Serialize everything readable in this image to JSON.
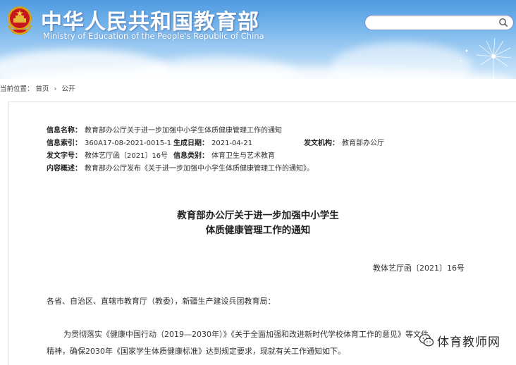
{
  "header": {
    "site_title": "中华人民共和国教育部",
    "site_subtitle": "Ministry of Education of the People's Republic of China",
    "search": {
      "value": "",
      "placeholder": ""
    }
  },
  "breadcrumb": {
    "prefix": "当前位置：",
    "items": [
      "首页",
      "公开"
    ],
    "separator": "›"
  },
  "meta": {
    "name_label": "信息名称：",
    "name_value": "教育部办公厅关于进一步加强中小学生体质健康管理工作的通知",
    "index_label": "信息索引：",
    "index_value": "360A17-08-2021-0015-1",
    "date_label": "生成日期：",
    "date_value": "2021-04-21",
    "org_label": "发文机构：",
    "org_value": "教育部办公厅",
    "docno_label": "发文字号：",
    "docno_value": "教体艺厅函〔2021〕16号",
    "category_label": "信息类别：",
    "category_value": "体育卫生与艺术教育",
    "summary_label": "内容概述：",
    "summary_value": "教育部办公厅发布《关于进一步加强中小学生体质健康管理工作的通知》。"
  },
  "document": {
    "title_line1": "教育部办公厅关于进一步加强中小学生",
    "title_line2": "体质健康管理工作的通知",
    "number": "教体艺厅函〔2021〕16号",
    "salutation": "各省、自治区、直辖市教育厅（教委），新疆生产建设兵团教育局：",
    "body_line1": "为贯彻落实《健康中国行动（2019—2030年）》《关于全面加强和改进新时代学校体育工作的意见》等文件",
    "body_line2": "精神，确保2030年《国家学生体质健康标准》达到规定要求，现就有关工作通知如下。"
  },
  "watermark": {
    "text": "体育教师网"
  },
  "colors": {
    "header_top": "#4f9be0",
    "header_bottom": "#d3e9fa",
    "search_border": "#6f8fd0"
  }
}
